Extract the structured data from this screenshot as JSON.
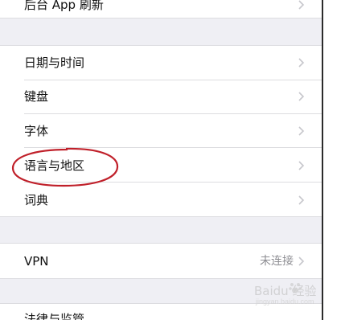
{
  "settings": {
    "rows": [
      {
        "label": "后台 App 刷新"
      },
      {
        "label": "日期与时间"
      },
      {
        "label": "键盘"
      },
      {
        "label": "字体"
      },
      {
        "label": "语言与地区"
      },
      {
        "label": "词典"
      },
      {
        "label": "VPN",
        "value": "未连接"
      },
      {
        "label": "法律与监管"
      }
    ]
  },
  "annotation": {
    "circle_color": "#c0202a"
  },
  "watermark": {
    "text": "Baidu 经验",
    "sub": "jingyan.baidu.com"
  },
  "colors": {
    "background": "#efeff4",
    "cell": "#ffffff",
    "chevron": "#c7c7cc",
    "value_text": "#8e8e93"
  }
}
